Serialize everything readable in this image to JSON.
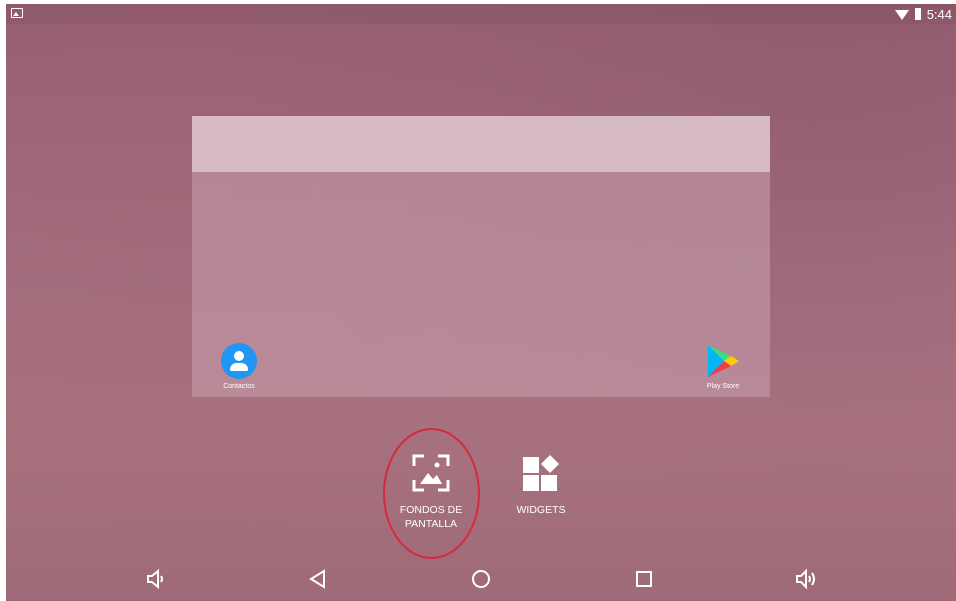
{
  "status_bar": {
    "time": "5:44",
    "left_icon": "image-notification-icon",
    "right_icons": [
      "wifi-icon",
      "battery-icon"
    ]
  },
  "preview": {
    "apps": [
      {
        "label": "Contactos",
        "icon": "contacts-icon",
        "color": "#2196f3"
      },
      {
        "label": "Play Store",
        "icon": "play-store-icon"
      }
    ]
  },
  "actions": [
    {
      "label": "FONDOS DE\nPANTALLA",
      "icon": "wallpaper-icon",
      "highlighted": true,
      "highlight_color": "#d62b3a"
    },
    {
      "label": "WIDGETS",
      "icon": "widgets-icon",
      "highlighted": false
    }
  ],
  "nav_bar": {
    "buttons": [
      "volume-down-icon",
      "back-icon",
      "home-icon",
      "recent-apps-icon",
      "volume-up-icon"
    ]
  }
}
